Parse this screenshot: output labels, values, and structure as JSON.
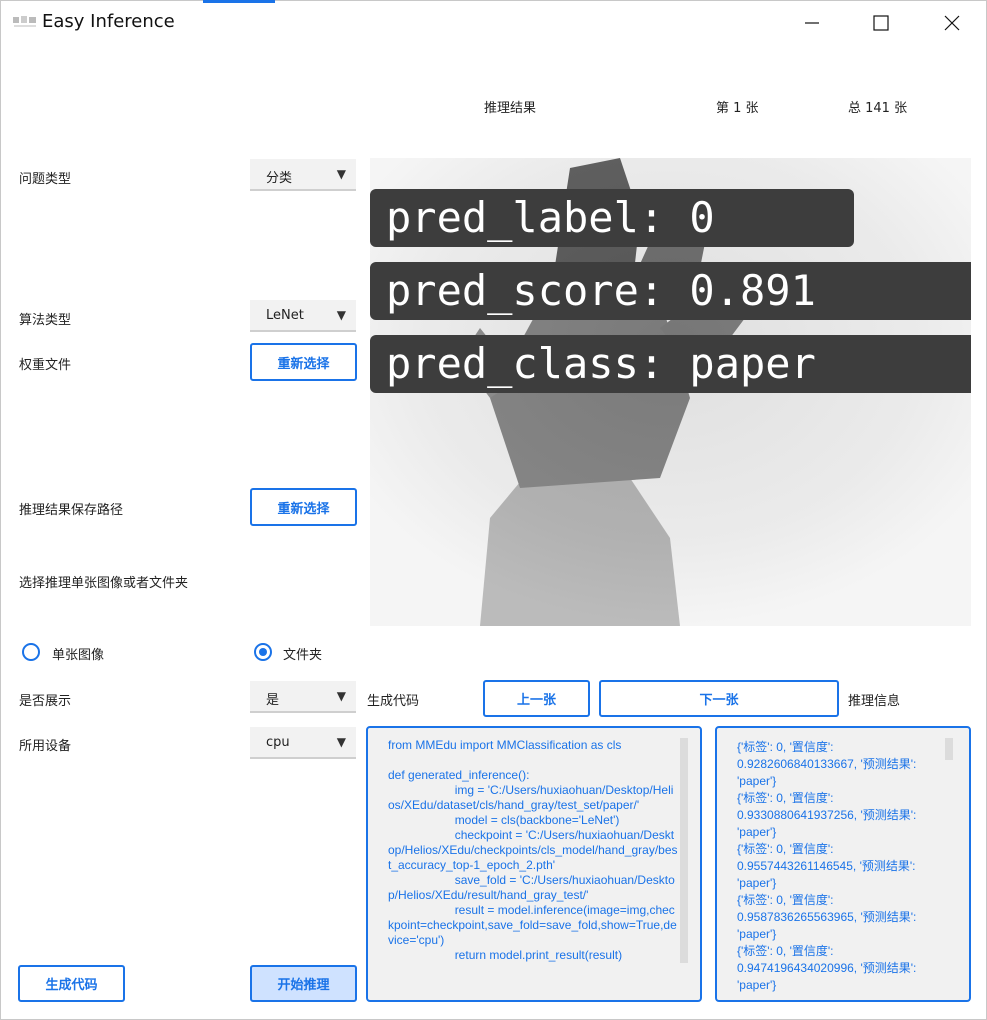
{
  "window": {
    "title": "Easy Inference",
    "controls": {
      "minimize": "minimize-icon",
      "maximize": "maximize-icon",
      "close": "close-icon"
    }
  },
  "header": {
    "result_label": "推理结果",
    "current_page": "第 1 张",
    "total_pages": "总 141 张"
  },
  "form": {
    "problem_type_label": "问题类型",
    "problem_type_value": "分类",
    "algorithm_label": "算法类型",
    "algorithm_value": "LeNet",
    "weight_label": "权重文件",
    "weight_button": "重新选择",
    "save_path_label": "推理结果保存路径",
    "save_path_button": "重新选择",
    "select_source_label": "选择推理单张图像或者文件夹",
    "radio_single": "单张图像",
    "radio_folder": "文件夹",
    "selected_source": "folder",
    "show_label": "是否展示",
    "show_value": "是",
    "device_label": "所用设备",
    "device_value": "cpu"
  },
  "preview": {
    "pred_label": "pred_label: 0",
    "pred_score": "pred_score: 0.891",
    "pred_class": "pred_class: paper"
  },
  "mid": {
    "gen_code_label": "生成代码",
    "prev_button": "上一张",
    "next_button": "下一张",
    "info_label": "推理信息"
  },
  "code_text": "from MMEdu import MMClassification as cls\n\ndef generated_inference():\n                    img = 'C:/Users/huxiaohuan/Desktop/Helios/XEdu/dataset/cls/hand_gray/test_set/paper/'\n                    model = cls(backbone='LeNet')\n                    checkpoint = 'C:/Users/huxiaohuan/Desktop/Helios/XEdu/checkpoints/cls_model/hand_gray/best_accuracy_top-1_epoch_2.pth'\n                    save_fold = 'C:/Users/huxiaohuan/Desktop/Helios/XEdu/result/hand_gray_test/'\n                    result = model.inference(image=img,checkpoint=checkpoint,save_fold=save_fold,show=True,device='cpu')\n                    return model.print_result(result)",
  "info_lines": [
    "{'标签': 0, '置信度':",
    "0.9282606840133667, '预测结果':",
    "'paper'}",
    "{'标签': 0, '置信度':",
    "0.9330880641937256, '预测结果':",
    "'paper'}",
    "{'标签': 0, '置信度':",
    "0.9557443261146545, '预测结果':",
    "'paper'}",
    "{'标签': 0, '置信度':",
    "0.9587836265563965, '预测结果':",
    "'paper'}",
    "{'标签': 0, '置信度':",
    "0.9474196434020996, '预测结果':",
    "'paper'}"
  ],
  "footer": {
    "generate_button": "生成代码",
    "start_button": "开始推理"
  },
  "colors": {
    "accent": "#1a73e8",
    "panel_bg": "#f1f1f1",
    "button_active": "#cfe2ff"
  }
}
